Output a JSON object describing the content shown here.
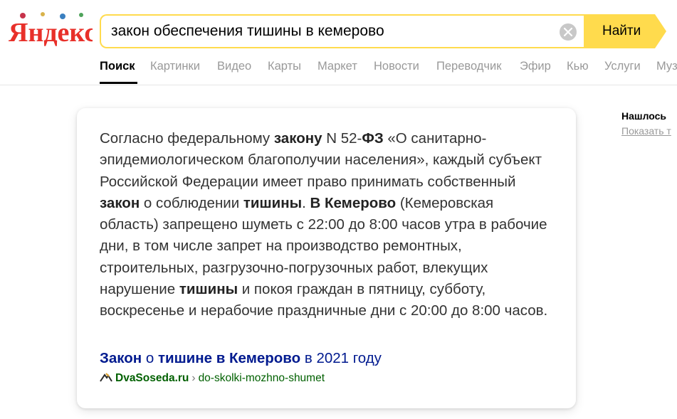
{
  "logo": {
    "text": "Яндекс"
  },
  "search": {
    "query": "закон обеспечения тишины в кемерово",
    "submit_label": "Найти"
  },
  "tabs": [
    {
      "label": "Поиск",
      "active": true
    },
    {
      "label": "Картинки"
    },
    {
      "label": "Видео"
    },
    {
      "label": "Карты"
    },
    {
      "label": "Маркет"
    },
    {
      "label": "Новости"
    },
    {
      "label": "Переводчик"
    },
    {
      "label": "Эфир"
    },
    {
      "label": "Кью"
    },
    {
      "label": "Услуги"
    },
    {
      "label": "Муз"
    }
  ],
  "sidebar": {
    "found": "Нашлось",
    "show": "Показать т"
  },
  "answer": {
    "segments": [
      {
        "t": "Согласно федеральному "
      },
      {
        "t": "закону",
        "b": true
      },
      {
        "t": " N 52-"
      },
      {
        "t": "ФЗ",
        "b": true
      },
      {
        "t": " «О санитарно-эпидемиологическом благополучии населения», каждый субъект Российской Федерации имеет право принимать собственный "
      },
      {
        "t": "закон",
        "b": true
      },
      {
        "t": " о соблюдении "
      },
      {
        "t": "тишины",
        "b": true
      },
      {
        "t": ". "
      },
      {
        "t": "В Кемерово",
        "b": true
      },
      {
        "t": " (Кемеровская область) запрещено шуметь с 22:00 до 8:00 часов утра в рабочие дни, в том числе запрет на производство ремонтных, строительных, разгрузочно-погрузочных работ, влекущих нарушение "
      },
      {
        "t": "тишины",
        "b": true
      },
      {
        "t": " и покоя граждан в пятницу, субботу, воскресенье и нерабочие праздничные дни с 20:00 до 8:00 часов."
      }
    ],
    "title": {
      "part1": "Закон",
      "part2": " о ",
      "part3": "тишине в Кемерово",
      "part4": " в 2021 году"
    },
    "domain": "DvaSoseda.ru",
    "separator": "›",
    "path": "do-skolki-mozhno-shumet"
  },
  "colors": {
    "accent": "#ffdb4d",
    "link": "#001a8f",
    "url_green": "#006000",
    "logo_red": "#e8302a"
  }
}
